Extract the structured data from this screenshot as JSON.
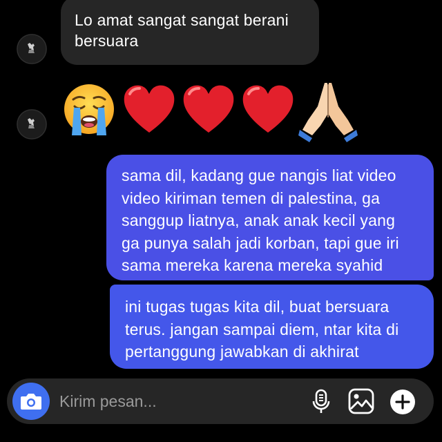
{
  "thread": {
    "incoming": {
      "text_lines": [
        "Lo amat sangat sangat berani",
        "bersuara"
      ]
    },
    "emoji_message": {
      "emojis": [
        "loudly-crying-face",
        "red-heart",
        "red-heart",
        "red-heart",
        "folded-hands"
      ]
    },
    "outgoing": [
      {
        "text_lines": [
          "sama dil, kadang gue nangis liat video",
          "video kiriman temen di palestina, ga",
          "sanggup liatnya, anak anak kecil yang",
          "ga punya salah jadi korban, tapi gue iri",
          "sama mereka karena mereka syahid"
        ]
      },
      {
        "text_lines": [
          "ini tugas tugas kita dil, buat bersuara",
          "terus. jangan sampai diem, ntar kita di",
          "pertanggung jawabkan di akhirat"
        ]
      }
    ]
  },
  "composer": {
    "placeholder": "Kirim pesan...",
    "value": "",
    "icons": [
      "camera-icon",
      "microphone-icon",
      "gallery-icon",
      "plus-icon"
    ]
  },
  "colors": {
    "background": "#000000",
    "incoming_bubble": "#262626",
    "outgoing_bubble": "#4a50e6",
    "camera_button": "#3f6ff0"
  }
}
